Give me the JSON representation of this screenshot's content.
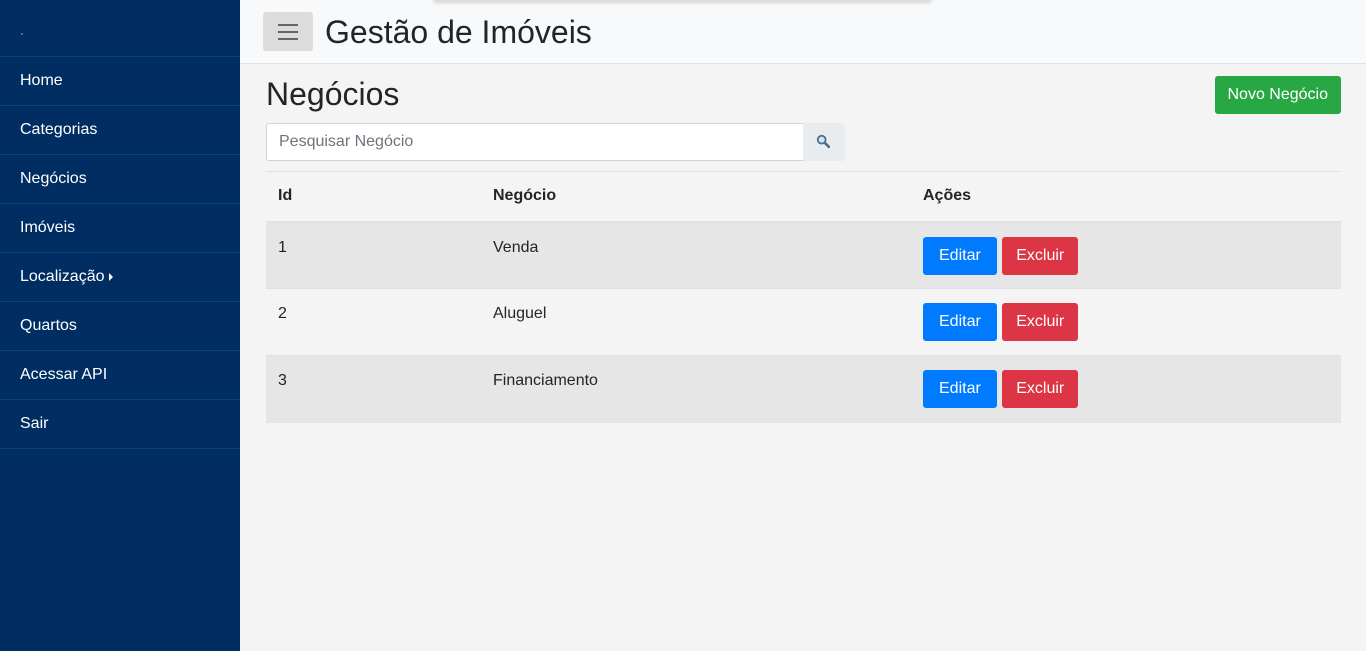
{
  "sidebar": {
    "items": [
      {
        "label": "Home"
      },
      {
        "label": "Categorias"
      },
      {
        "label": "Negócios"
      },
      {
        "label": "Imóveis"
      },
      {
        "label": "Localização",
        "has_submenu": true
      },
      {
        "label": "Quartos"
      },
      {
        "label": "Acessar API"
      },
      {
        "label": "Sair"
      }
    ]
  },
  "header": {
    "menu_icon": "hamburger-icon",
    "title": "Gestão de Imóveis"
  },
  "main": {
    "page_title": "Negócios",
    "new_button_label": "Novo Negócio",
    "search": {
      "placeholder": "Pesquisar Negócio",
      "value": "",
      "icon": "magnifier-icon"
    },
    "table": {
      "columns": [
        "Id",
        "Negócio",
        "Ações"
      ],
      "rows": [
        {
          "id": "1",
          "name": "Venda",
          "edit_label": "Editar",
          "delete_label": "Excluir"
        },
        {
          "id": "2",
          "name": "Aluguel",
          "edit_label": "Editar",
          "delete_label": "Excluir"
        },
        {
          "id": "3",
          "name": "Financiamento",
          "edit_label": "Editar",
          "delete_label": "Excluir"
        }
      ]
    }
  },
  "colors": {
    "sidebar_bg": "#002e63",
    "primary": "#007bff",
    "success": "#28a745",
    "danger": "#dc3545"
  }
}
